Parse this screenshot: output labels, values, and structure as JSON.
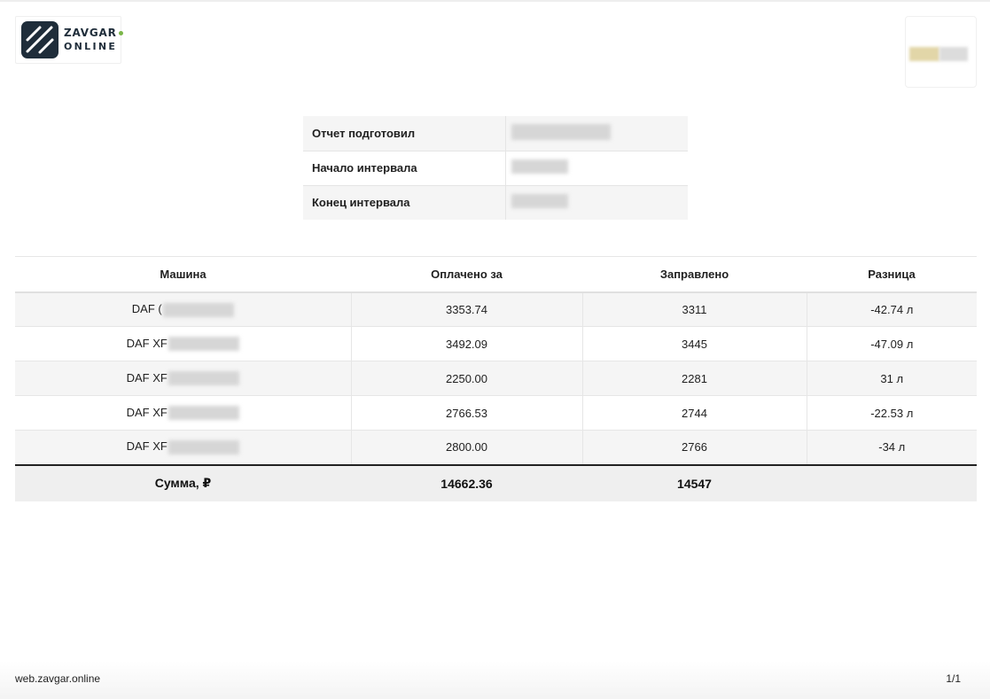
{
  "header": {
    "logo_line1": "ZAVGAR",
    "logo_line2": "ONLINE",
    "brand_colors": {
      "dark": "#1f2d3a",
      "accent": "#7ab648"
    }
  },
  "info": {
    "rows": [
      {
        "label": "Отчет подготовил"
      },
      {
        "label": "Начало интервала"
      },
      {
        "label": "Конец интервала"
      }
    ]
  },
  "table": {
    "columns": [
      "Машина",
      "Оплачено за",
      "Заправлено",
      "Разница"
    ],
    "rows": [
      {
        "car": "DAF (",
        "paid": "3353.74",
        "fueled": "3311",
        "diff": "-42.74 л"
      },
      {
        "car": "DAF XF",
        "paid": "3492.09",
        "fueled": "3445",
        "diff": "-47.09 л"
      },
      {
        "car": "DAF XF",
        "paid": "2250.00",
        "fueled": "2281",
        "diff": "31 л"
      },
      {
        "car": "DAF XF",
        "paid": "2766.53",
        "fueled": "2744",
        "diff": "-22.53 л"
      },
      {
        "car": "DAF XF",
        "paid": "2800.00",
        "fueled": "2766",
        "diff": "-34 л"
      }
    ],
    "total": {
      "label": "Сумма, ₽",
      "paid": "14662.36",
      "fueled": "14547",
      "diff": ""
    }
  },
  "footer": {
    "url": "web.zavgar.online",
    "page": "1/1"
  }
}
